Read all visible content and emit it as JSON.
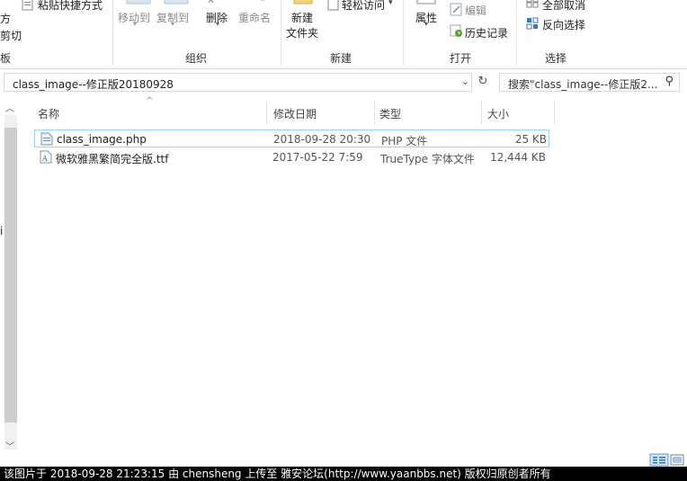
{
  "ribbon": {
    "clipboard": {
      "paste_shortcut": "粘贴快捷方式",
      "frag_fang": "方",
      "frag_cut": "剪切",
      "label_frag": "板"
    },
    "organize": {
      "move_to": "移动到",
      "copy_to": "复制到",
      "delete": "删除",
      "rename": "重命名",
      "label": "组织"
    },
    "new": {
      "new_folder_line1": "新建",
      "new_folder_line2": "文件夹",
      "easy_access": "轻松访问",
      "label": "新建"
    },
    "open": {
      "properties": "属性",
      "edit": "编辑",
      "history": "历史记录",
      "label": "打开"
    },
    "select": {
      "select_none": "全部取消",
      "invert_selection": "反向选择",
      "label": "选择"
    }
  },
  "address": {
    "path": "class_image--修正版20180928",
    "search_placeholder": "搜索\"class_image--修正版2..."
  },
  "columns": {
    "name": "名称",
    "modified": "修改日期",
    "type": "类型",
    "size": "大小"
  },
  "files": [
    {
      "name": "class_image.php",
      "modified": "2018-09-28 20:30",
      "type": "PHP 文件",
      "size": "25 KB",
      "icon": "php-file-icon"
    },
    {
      "name": "微软雅黑繁简完全版.ttf",
      "modified": "2017-05-22 7:59",
      "type": "TrueType 字体文件",
      "size": "12,444 KB",
      "icon": "font-file-icon"
    }
  ],
  "navpane": {
    "frag": "i"
  },
  "footer": {
    "text": "该图片于 2018-09-28 21:23:15 由 chensheng 上传至 雅安论坛(http://www.yaanbbs.net) 版权归原创者所有"
  },
  "colors": {
    "selection_border": "#99d1ff",
    "footer_bg": "#000000",
    "disabled_text": "#8a8a8a"
  }
}
